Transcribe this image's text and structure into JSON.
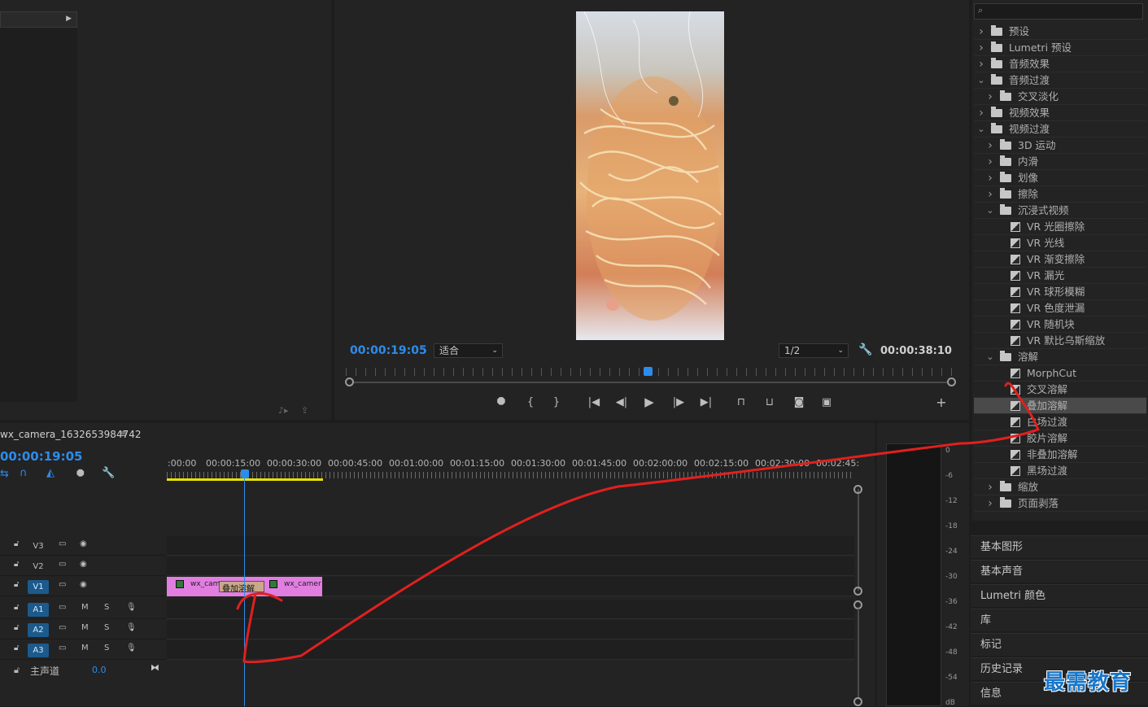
{
  "program_monitor": {
    "current_time": "00:00:19:05",
    "fit_select": "适合",
    "resolution_select": "1/2",
    "duration": "00:00:38:10"
  },
  "effects": {
    "search_placeholder": "",
    "items": [
      {
        "label": "预设",
        "level": 0,
        "kind": "folder",
        "open": false
      },
      {
        "label": "Lumetri 预设",
        "level": 0,
        "kind": "folder",
        "open": false
      },
      {
        "label": "音频效果",
        "level": 0,
        "kind": "folder",
        "open": false
      },
      {
        "label": "音频过渡",
        "level": 0,
        "kind": "folder",
        "open": true
      },
      {
        "label": "交叉淡化",
        "level": 1,
        "kind": "folder",
        "open": false
      },
      {
        "label": "视频效果",
        "level": 0,
        "kind": "folder",
        "open": false
      },
      {
        "label": "视频过渡",
        "level": 0,
        "kind": "folder",
        "open": true
      },
      {
        "label": "3D 运动",
        "level": 1,
        "kind": "folder",
        "open": false
      },
      {
        "label": "内滑",
        "level": 1,
        "kind": "folder",
        "open": false
      },
      {
        "label": "划像",
        "level": 1,
        "kind": "folder",
        "open": false
      },
      {
        "label": "擦除",
        "level": 1,
        "kind": "folder",
        "open": false
      },
      {
        "label": "沉浸式视频",
        "level": 1,
        "kind": "folder",
        "open": true
      },
      {
        "label": "VR 光圈擦除",
        "level": 2,
        "kind": "effect"
      },
      {
        "label": "VR 光线",
        "level": 2,
        "kind": "effect"
      },
      {
        "label": "VR 渐变擦除",
        "level": 2,
        "kind": "effect"
      },
      {
        "label": "VR 漏光",
        "level": 2,
        "kind": "effect"
      },
      {
        "label": "VR 球形模糊",
        "level": 2,
        "kind": "effect"
      },
      {
        "label": "VR 色度泄漏",
        "level": 2,
        "kind": "effect"
      },
      {
        "label": "VR 随机块",
        "level": 2,
        "kind": "effect"
      },
      {
        "label": "VR 默比乌斯缩放",
        "level": 2,
        "kind": "effect"
      },
      {
        "label": "溶解",
        "level": 1,
        "kind": "folder",
        "open": true
      },
      {
        "label": "MorphCut",
        "level": 2,
        "kind": "effect"
      },
      {
        "label": "交叉溶解",
        "level": 2,
        "kind": "effect"
      },
      {
        "label": "叠加溶解",
        "level": 2,
        "kind": "effect",
        "selected": true
      },
      {
        "label": "白场过渡",
        "level": 2,
        "kind": "effect"
      },
      {
        "label": "胶片溶解",
        "level": 2,
        "kind": "effect"
      },
      {
        "label": "非叠加溶解",
        "level": 2,
        "kind": "effect"
      },
      {
        "label": "黑场过渡",
        "level": 2,
        "kind": "effect"
      },
      {
        "label": "缩放",
        "level": 1,
        "kind": "folder",
        "open": false
      },
      {
        "label": "页面剥落",
        "level": 1,
        "kind": "folder",
        "open": false
      }
    ]
  },
  "side_panels": [
    "基本图形",
    "基本声音",
    "Lumetri 颜色",
    "库",
    "标记",
    "历史记录",
    "信息"
  ],
  "timeline": {
    "sequence_name": "wx_camera_1632653984742",
    "current_time": "00:00:19:05",
    "ruler_labels": [
      ":00:00",
      "00:00:15:00",
      "00:00:30:00",
      "00:00:45:00",
      "00:01:00:00",
      "00:01:15:00",
      "00:01:30:00",
      "00:01:45:00",
      "00:02:00:00",
      "00:02:15:00",
      "00:02:30:00",
      "00:02:45:"
    ],
    "tracks": [
      {
        "label": "V3",
        "type": "video",
        "targeted": false
      },
      {
        "label": "V2",
        "type": "video",
        "targeted": false
      },
      {
        "label": "V1",
        "type": "video",
        "targeted": true
      },
      {
        "label": "A1",
        "type": "audio",
        "targeted": true
      },
      {
        "label": "A2",
        "type": "audio",
        "targeted": true
      },
      {
        "label": "A3",
        "type": "audio",
        "targeted": true
      }
    ],
    "master": {
      "label": "主声道",
      "value": "0.0"
    },
    "clip_left": "wx_cam",
    "clip_right": "wx_camer",
    "transition": "叠加溶解"
  },
  "meter_scale": [
    "0",
    "-6",
    "-12",
    "-18",
    "-24",
    "-30",
    "-36",
    "-42",
    "-48",
    "-54",
    "dB"
  ],
  "watermark": "最需教育",
  "colors": {
    "accent_blue": "#2d8ceb",
    "clip_pink": "#e17ee0",
    "annotation_red": "#e0201e",
    "work_area_yellow": "#e8e000"
  }
}
